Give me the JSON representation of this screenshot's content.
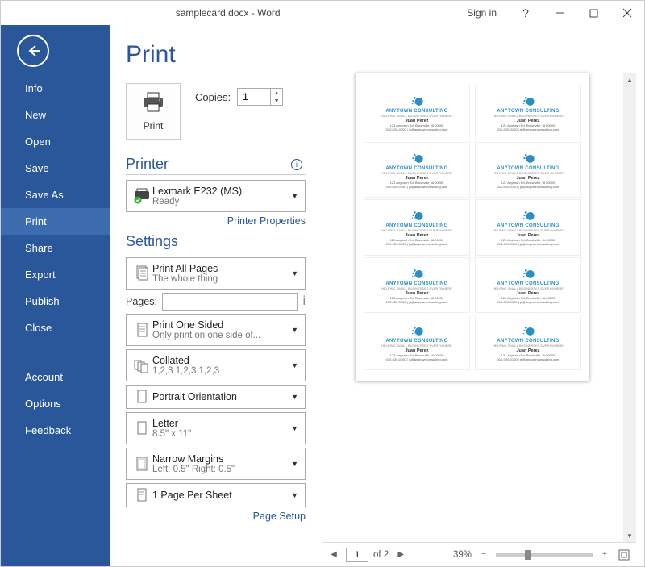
{
  "title": "samplecard.docx - Word",
  "signin": "Sign in",
  "sidebar": {
    "items": [
      "Info",
      "New",
      "Open",
      "Save",
      "Save As",
      "Print",
      "Share",
      "Export",
      "Publish",
      "Close"
    ],
    "bottom": [
      "Account",
      "Options",
      "Feedback"
    ],
    "active": "Print"
  },
  "page_heading": "Print",
  "print_button": "Print",
  "copies": {
    "label": "Copies:",
    "value": "1"
  },
  "printer": {
    "heading": "Printer",
    "name": "Lexmark E232 (MS)",
    "status": "Ready",
    "properties_link": "Printer Properties"
  },
  "settings": {
    "heading": "Settings",
    "print_all": {
      "line1": "Print All Pages",
      "line2": "The whole thing"
    },
    "pages_label": "Pages:",
    "pages_value": "",
    "sides": {
      "line1": "Print One Sided",
      "line2": "Only print on one side of..."
    },
    "collate": {
      "line1": "Collated",
      "line2": "1,2,3    1,2,3    1,2,3"
    },
    "orientation": {
      "line1": "Portrait Orientation"
    },
    "paper": {
      "line1": "Letter",
      "line2": "8.5\" x 11\""
    },
    "margins": {
      "line1": "Narrow Margins",
      "line2": "Left:  0.5\"    Right:  0.5\""
    },
    "per_sheet": {
      "line1": "1 Page Per Sheet"
    },
    "page_setup_link": "Page Setup"
  },
  "preview": {
    "card": {
      "company": "ANYTOWN CONSULTING",
      "tagline": "HELPING SMALL BUSINESSES EVERYWHERE",
      "person": "Juan Perez",
      "addr1": "123 Anytown Rd, Brushville, IA 00000",
      "addr2": "010-020-0100 | js@anytownconsulting.com"
    },
    "nav": {
      "current": "1",
      "total": "of 2"
    },
    "zoom": "39%"
  }
}
